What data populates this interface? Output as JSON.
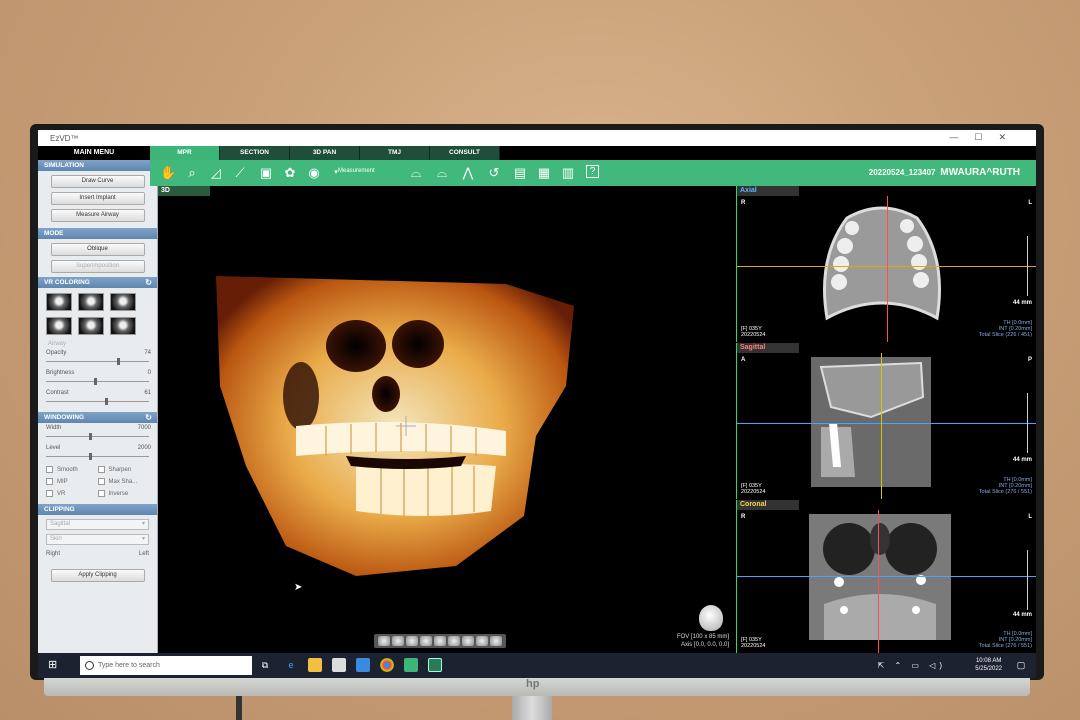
{
  "app": {
    "title": "EzVD™",
    "window_controls": [
      "—",
      "☐",
      "✕"
    ]
  },
  "left_panel": {
    "main_menu": "MAIN MENU",
    "simulation": {
      "header": "SIMULATION",
      "buttons": [
        "Draw Curve",
        "Insert Implant",
        "Measure Airway"
      ]
    },
    "mode": {
      "header": "MODE",
      "buttons": [
        "Oblique",
        "Superimposition"
      ]
    },
    "vr_coloring": {
      "header": "VR COLORING",
      "airway_label": "Airway",
      "sliders": [
        {
          "label": "Opacity",
          "value": "74",
          "level": 0.74
        },
        {
          "label": "Brightness",
          "value": "0",
          "level": 0.5
        },
        {
          "label": "Contrast",
          "value": "61",
          "level": 0.61
        }
      ]
    },
    "windowing": {
      "header": "WINDOWING",
      "sliders": [
        {
          "label": "Width",
          "value": "7000",
          "level": 0.45
        },
        {
          "label": "Level",
          "value": "2000",
          "level": 0.45
        }
      ],
      "options": [
        "Smooth",
        "Sharpen",
        "MIP",
        "Max Sha...",
        "VR",
        "Inverse"
      ]
    },
    "clipping": {
      "header": "CLIPPING",
      "dropdowns": [
        "Sagittal",
        "Skin"
      ],
      "right_label": "Right",
      "left_label": "Left",
      "apply_button": "Apply Clipping"
    }
  },
  "tabs": [
    "MPR",
    "SECTION",
    "3D PAN",
    "TMJ",
    "CONSULT"
  ],
  "active_tab": "MPR",
  "toolbar": {
    "measurement_label": "Measurement",
    "patient_id": "20220524_123407",
    "patient_name": "MWAURA^RUTH",
    "icons": [
      "hand-icon",
      "zoom-icon",
      "angle-icon",
      "curve-icon",
      "camera-icon",
      "implant-icon",
      "nerve-icon",
      "arch-icon",
      "arch-2-icon",
      "arch-3-icon",
      "reset-icon",
      "layout-1-icon",
      "layout-2-icon",
      "layout-3-icon",
      "help-icon"
    ]
  },
  "view3d": {
    "label": "3D",
    "fov": "FOV [100 x 85 mm]",
    "axis": "Axis [0.0, 0.0, 0.0]"
  },
  "mpr_views": [
    {
      "name": "Axial",
      "color": "#5ab4ff",
      "tl": "R",
      "tr": "L",
      "mm": "44 mm",
      "info_left": [
        "[F] 035Y",
        "20220524"
      ],
      "info_right": [
        "TH [0.0mm]",
        "INT [0.20mm]",
        "Total Slice (226 / 451)"
      ]
    },
    {
      "name": "Sagittal",
      "color": "#ff7f7f",
      "tl": "A",
      "tr": "P",
      "mm": "44 mm",
      "info_left": [
        "[F] 035Y",
        "20220524"
      ],
      "info_right": [
        "TH [0.0mm]",
        "INT [0.20mm]",
        "Total Slice (276 / 551)"
      ]
    },
    {
      "name": "Coronal",
      "color": "#ffd34a",
      "tl": "R",
      "tr": "L",
      "mm": "44 mm",
      "info_left": [
        "[F] 035Y",
        "20220524"
      ],
      "info_right": [
        "TH [0.0mm]",
        "INT [0.20mm]",
        "Total Slice (276 / 551)"
      ]
    }
  ],
  "taskbar": {
    "search_placeholder": "Type here to search",
    "time": "10:08 AM",
    "date": "5/25/2022"
  },
  "monitor_brand": "hp"
}
